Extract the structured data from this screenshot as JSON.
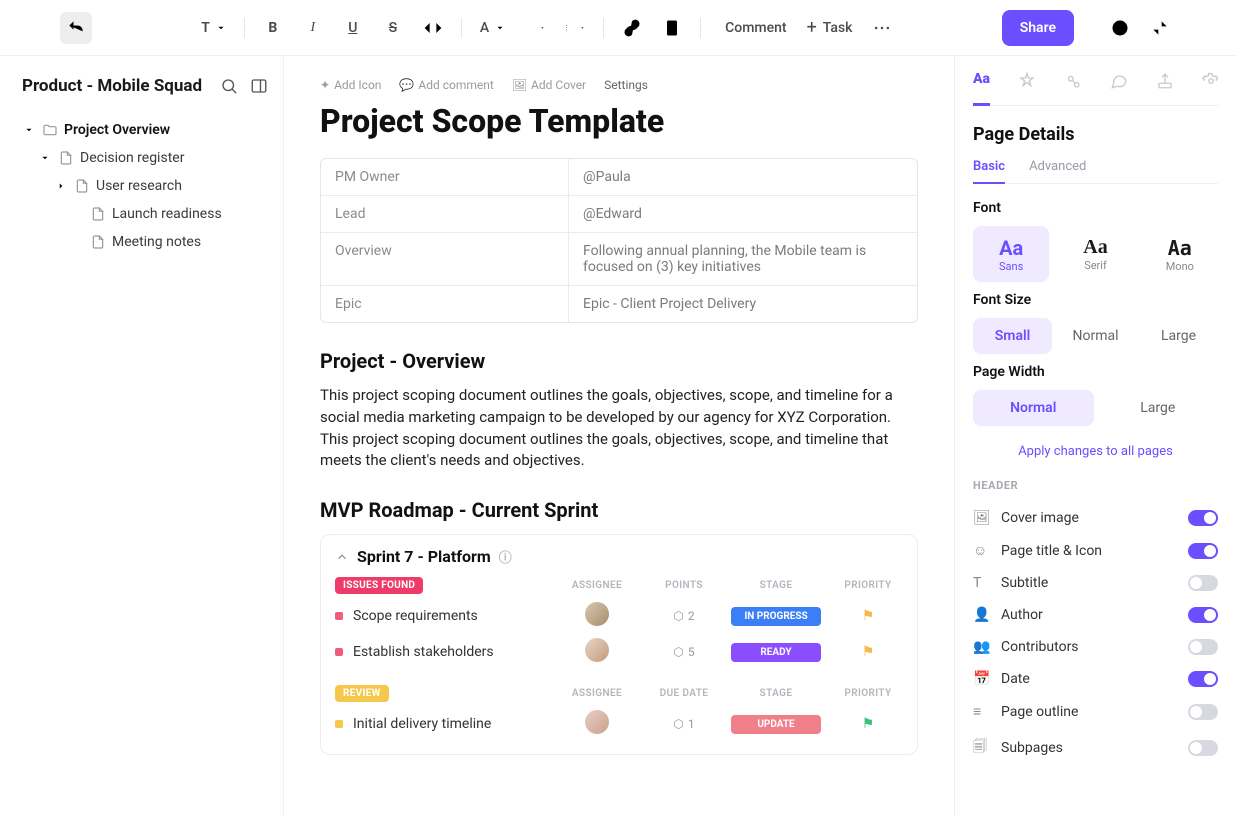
{
  "toolbar": {
    "comment": "Comment",
    "task": "Task",
    "share": "Share"
  },
  "sidebar": {
    "workspace": "Product - Mobile Squad",
    "tree": [
      {
        "label": "Project Overview",
        "bold": true,
        "level": 0
      },
      {
        "label": "Decision register",
        "level": 1
      },
      {
        "label": "User research",
        "level": 2
      },
      {
        "label": "Launch readiness",
        "level": 3
      },
      {
        "label": "Meeting notes",
        "level": 3
      }
    ]
  },
  "doc": {
    "actions": {
      "addIcon": "Add Icon",
      "addComment": "Add comment",
      "addCover": "Add Cover",
      "settings": "Settings"
    },
    "title": "Project Scope Template",
    "props": [
      {
        "k": "PM Owner",
        "v": "@Paula"
      },
      {
        "k": "Lead",
        "v": "@Edward"
      },
      {
        "k": "Overview",
        "v": "Following annual planning, the Mobile team is focused on (3) key initiatives"
      },
      {
        "k": "Epic",
        "v": "Epic - Client Project Delivery"
      }
    ],
    "overviewHead": "Project - Overview",
    "overviewBody": "This project scoping document outlines the goals, objectives, scope, and timeline for a social media marketing campaign to be developed by our agency for XYZ Corporation. This project scoping document outlines the goals, objectives, scope, and timeline that meets the client's needs and objectives.",
    "roadmapHead": "MVP Roadmap - Current Sprint",
    "sprint": {
      "title": "Sprint  7 - Platform",
      "group1": {
        "label": "ISSUES FOUND",
        "cols": {
          "assignee": "ASSIGNEE",
          "points": "POINTS",
          "stage": "STAGE",
          "priority": "PRIORITY"
        },
        "rows": [
          {
            "name": "Scope requirements",
            "points": "2",
            "stage": "IN PROGRESS",
            "stageClass": "progress"
          },
          {
            "name": "Establish stakeholders",
            "points": "5",
            "stage": "READY",
            "stageClass": "ready"
          }
        ]
      },
      "group2": {
        "label": "REVIEW",
        "cols": {
          "assignee": "ASSIGNEE",
          "due": "DUE DATE",
          "stage": "STAGE",
          "priority": "PRIORITY"
        },
        "rows": [
          {
            "name": "Initial delivery timeline",
            "points": "1",
            "stage": "UPDATE",
            "stageClass": "update"
          }
        ]
      }
    }
  },
  "details": {
    "title": "Page Details",
    "tabs": {
      "basic": "Basic",
      "advanced": "Advanced"
    },
    "font": {
      "label": "Font",
      "sans": "Sans",
      "serif": "Serif",
      "mono": "Mono",
      "glyph": "Aa"
    },
    "fontSize": {
      "label": "Font Size",
      "small": "Small",
      "normal": "Normal",
      "large": "Large"
    },
    "pageWidth": {
      "label": "Page Width",
      "normal": "Normal",
      "large": "Large"
    },
    "applyAll": "Apply changes to all pages",
    "headerLabel": "HEADER",
    "rows": [
      {
        "label": "Cover image",
        "on": true
      },
      {
        "label": "Page title & Icon",
        "on": true
      },
      {
        "label": "Subtitle",
        "on": false
      },
      {
        "label": "Author",
        "on": true
      },
      {
        "label": "Contributors",
        "on": false
      },
      {
        "label": "Date",
        "on": true
      },
      {
        "label": "Page outline",
        "on": false
      },
      {
        "label": "Subpages",
        "on": false
      }
    ]
  }
}
